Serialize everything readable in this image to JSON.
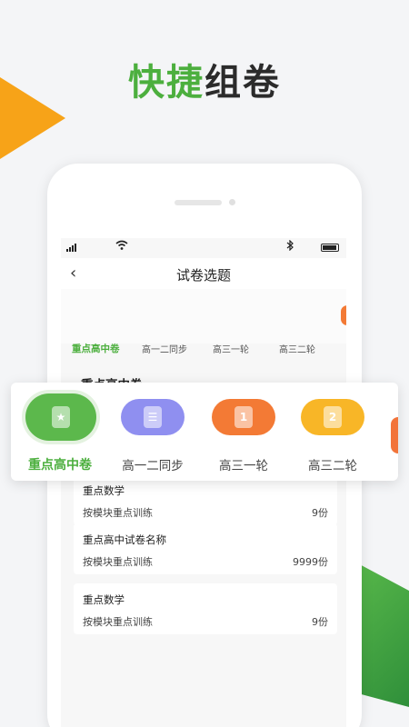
{
  "promo": {
    "title_green": "快捷",
    "title_dark": "组卷",
    "accent_green": "#4caf3e",
    "accent_orange": "#f7a318"
  },
  "status_bar": {
    "wifi_icon": "wifi-icon",
    "bluetooth_icon": "bluetooth-icon"
  },
  "nav": {
    "back_label": "‹",
    "title": "试卷选题"
  },
  "tabs": [
    "重点高中卷",
    "高一二同步",
    "高三一轮",
    "高三二轮"
  ],
  "active_tab": 0,
  "section": {
    "title": "重点高中卷"
  },
  "papers": [
    {
      "name": "重点数学",
      "sub": "按模块重点训练",
      "count": "9份"
    },
    {
      "name": "重点高中试卷名称",
      "sub": "按模块重点训练",
      "count": "9999份"
    },
    {
      "name": "重点数学",
      "sub": "按模块重点训练",
      "count": "9份"
    }
  ],
  "categories": [
    {
      "label": "重点高中卷",
      "icon": "star-doc-icon",
      "glyph": "★",
      "color": "#5cb84c"
    },
    {
      "label": "高一二同步",
      "icon": "document-icon",
      "glyph": "☰",
      "color": "#8f8ff0"
    },
    {
      "label": "高三一轮",
      "icon": "number-one-icon",
      "glyph": "1",
      "color": "#f37a35"
    },
    {
      "label": "高三二轮",
      "icon": "number-two-icon",
      "glyph": "2",
      "color": "#f8b627"
    }
  ]
}
